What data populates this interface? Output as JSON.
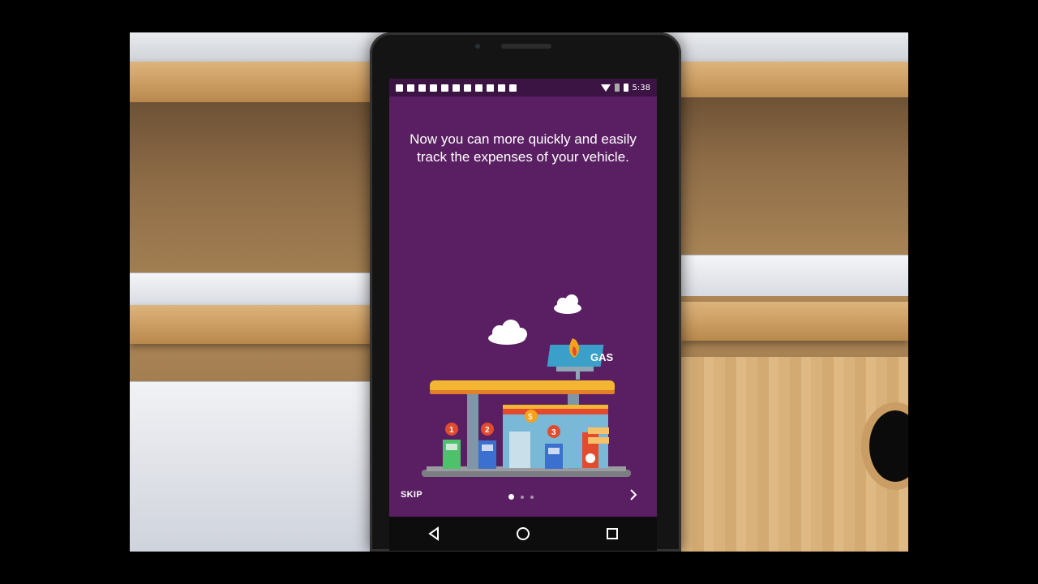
{
  "status_bar": {
    "time": "5:38"
  },
  "onboarding": {
    "headline": "Now you can more quickly and easily track the expenses of your vehicle.",
    "illustration": {
      "sign_text": "GAS",
      "pump_numbers": [
        "1",
        "2",
        "3"
      ],
      "price_symbol": "$"
    },
    "skip_label": "SKIP",
    "next_icon": "chevron-right-icon",
    "page_indicator": {
      "total": 3,
      "active": 1
    }
  },
  "nav_bar": {
    "back_icon": "back-triangle-icon",
    "home_icon": "home-circle-icon",
    "recents_icon": "recents-square-icon"
  },
  "colors": {
    "screen_background": "#5a1f63",
    "status_bar": "#3c1444",
    "canopy": "#f2b632",
    "accent_red": "#e24b2e"
  }
}
